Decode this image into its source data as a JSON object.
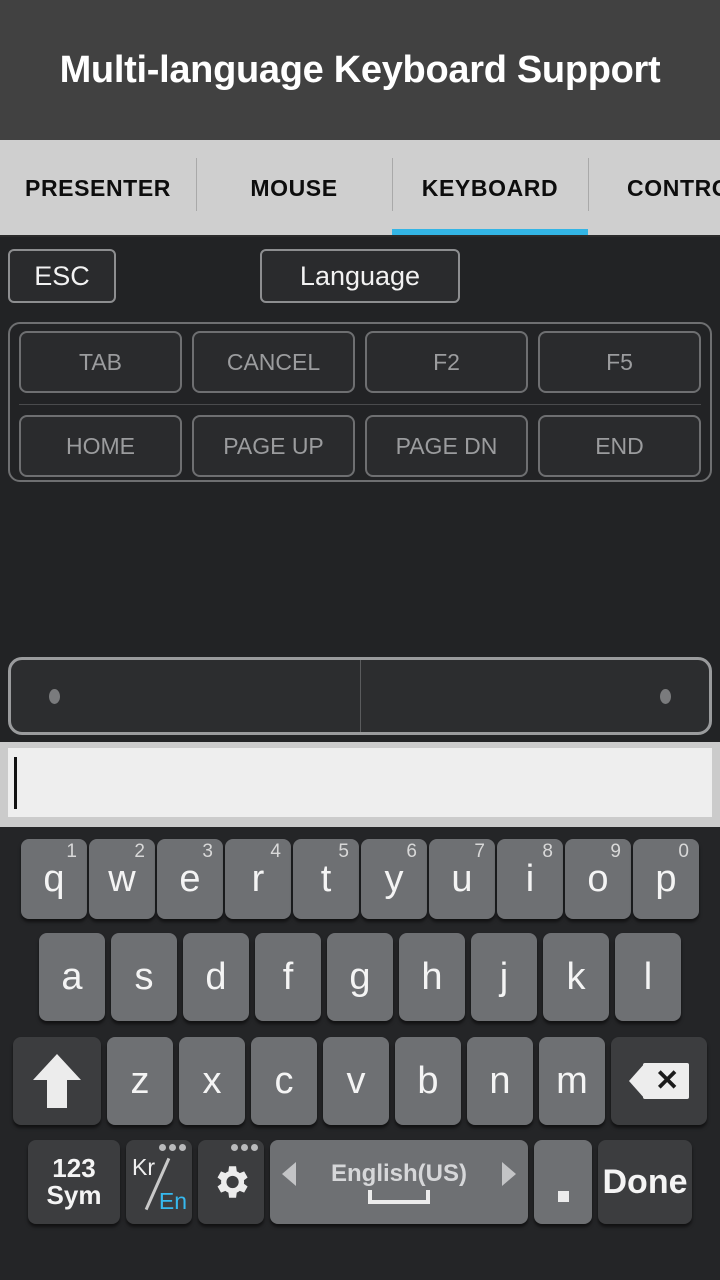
{
  "header": {
    "title": "Multi-language Keyboard Support"
  },
  "tabs": [
    {
      "label": "PRESENTER",
      "active": false
    },
    {
      "label": "MOUSE",
      "active": false
    },
    {
      "label": "KEYBOARD",
      "active": true
    },
    {
      "label": "CONTROL",
      "active": false
    }
  ],
  "accent_color": "#33b5e5",
  "remote": {
    "esc_label": "ESC",
    "language_label": "Language",
    "function_rows": [
      [
        "TAB",
        "CANCEL",
        "F2",
        "F5"
      ],
      [
        "HOME",
        "PAGE UP",
        "PAGE DN",
        "END"
      ]
    ]
  },
  "text_input": {
    "value": "",
    "placeholder": ""
  },
  "keyboard": {
    "row1": [
      {
        "letter": "q",
        "number": "1"
      },
      {
        "letter": "w",
        "number": "2"
      },
      {
        "letter": "e",
        "number": "3"
      },
      {
        "letter": "r",
        "number": "4"
      },
      {
        "letter": "t",
        "number": "5"
      },
      {
        "letter": "y",
        "number": "6"
      },
      {
        "letter": "u",
        "number": "7"
      },
      {
        "letter": "i",
        "number": "8"
      },
      {
        "letter": "o",
        "number": "9"
      },
      {
        "letter": "p",
        "number": "0"
      }
    ],
    "row2": [
      {
        "letter": "a"
      },
      {
        "letter": "s"
      },
      {
        "letter": "d"
      },
      {
        "letter": "f"
      },
      {
        "letter": "g"
      },
      {
        "letter": "h"
      },
      {
        "letter": "j"
      },
      {
        "letter": "k"
      },
      {
        "letter": "l"
      }
    ],
    "row3": [
      {
        "letter": "z"
      },
      {
        "letter": "x"
      },
      {
        "letter": "c"
      },
      {
        "letter": "v"
      },
      {
        "letter": "b"
      },
      {
        "letter": "n"
      },
      {
        "letter": "m"
      }
    ],
    "shift_icon": "shift-arrow-icon",
    "backspace_icon": "backspace-icon",
    "row4": {
      "sym_line1": "123",
      "sym_line2": "Sym",
      "lang_switch_from": "Kr",
      "lang_switch_to": "En",
      "lang_switch_to_color": "#36b9ef",
      "settings_icon": "gear-icon",
      "space_label": "English(US)",
      "period_label": ".",
      "done_label": "Done"
    }
  }
}
